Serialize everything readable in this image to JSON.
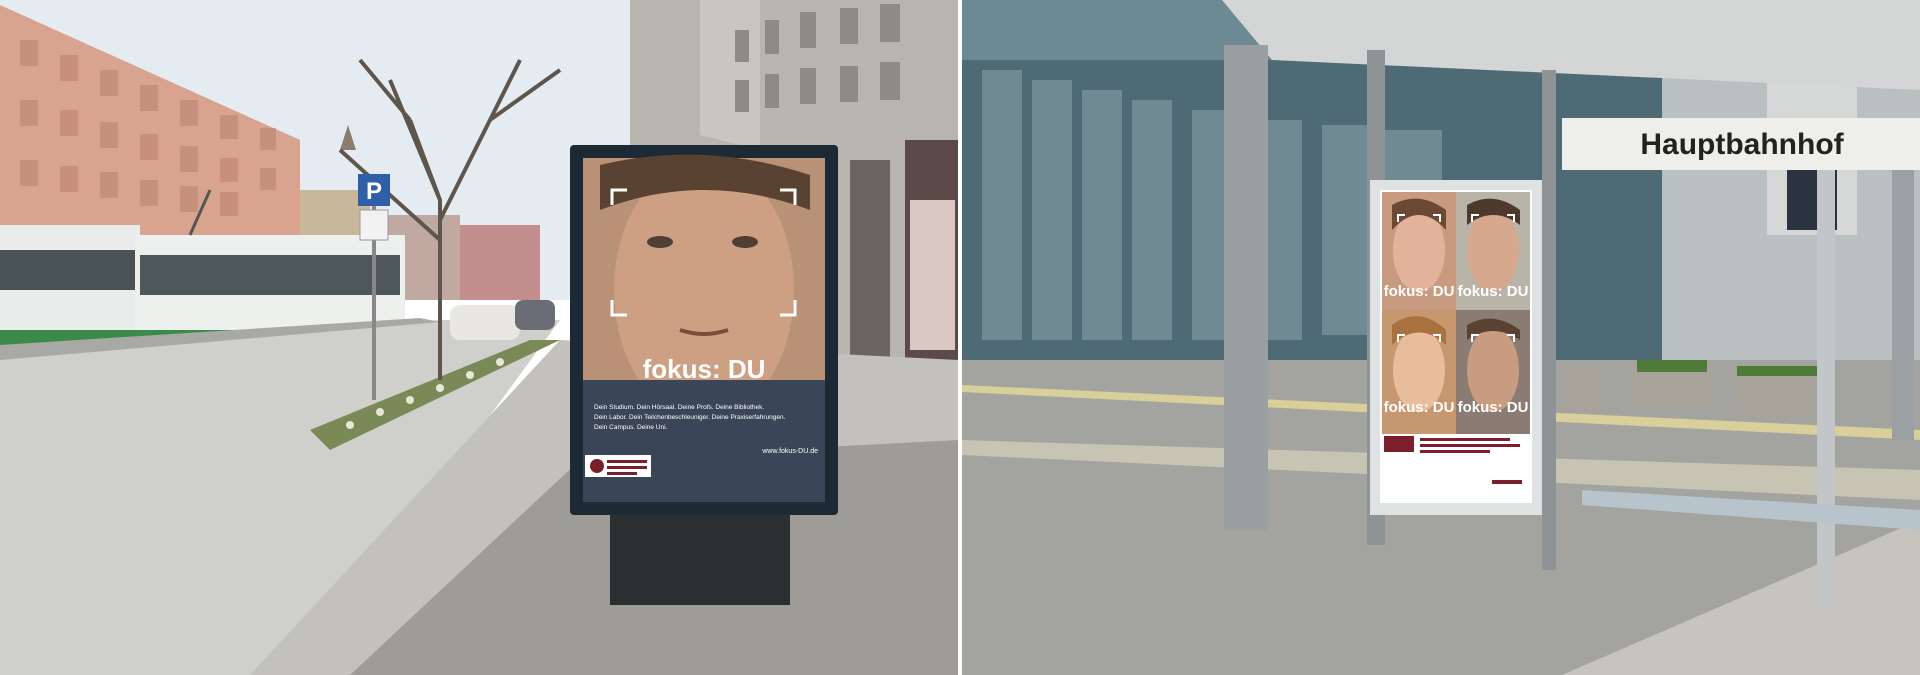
{
  "left_poster": {
    "headline": "fokus: DU",
    "tagline_1": "Dein Studium. Dein Hörsaal. Deine Profs. Deine Bibliothek.",
    "tagline_2": "Dein Labor. Dein Teilchenbeschleuniger. Deine Praxiserfahrungen.",
    "tagline_3": "Dein Campus. Deine Uni.",
    "url": "www.fokus-DU.de"
  },
  "street_sign": {
    "parking_letter": "P"
  },
  "right_poster": {
    "face_labels": [
      "fokus: DU",
      "fokus: DU",
      "fokus: DU",
      "fokus: DU"
    ]
  },
  "station_sign": {
    "name": "Hauptbahnhof"
  },
  "colors": {
    "tram_green": "#3c8a4a",
    "poster_frame": "#1a2a36",
    "sky": "#e8eef3",
    "facade_pink": "#d9a08a"
  }
}
